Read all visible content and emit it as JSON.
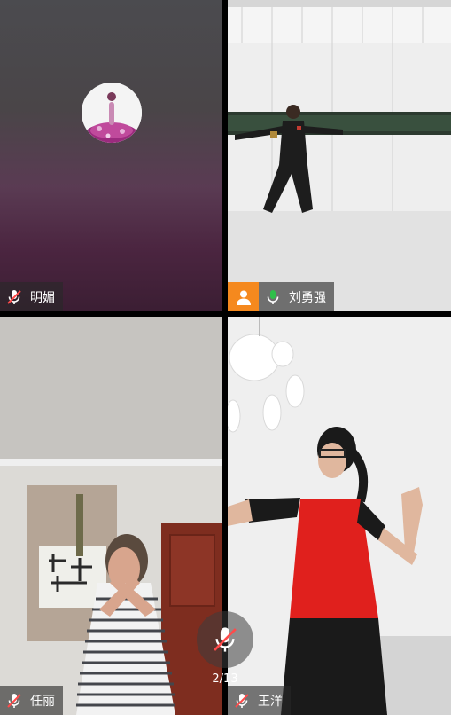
{
  "participants": [
    {
      "name": "明媚",
      "mic": "muted",
      "host": false
    },
    {
      "name": "刘勇强",
      "mic": "on",
      "host": true
    },
    {
      "name": "任丽",
      "mic": "muted",
      "host": false
    },
    {
      "name": "王洋",
      "mic": "muted",
      "host": false
    }
  ],
  "page_indicator": "2/13",
  "icons": {
    "muted": "mic-muted-icon",
    "on": "mic-on-icon",
    "host": "host-user-icon"
  },
  "colors": {
    "host_badge": "#f5891e",
    "mic_on": "#2fbf4a",
    "mic_muted": "#ff4a4a"
  }
}
